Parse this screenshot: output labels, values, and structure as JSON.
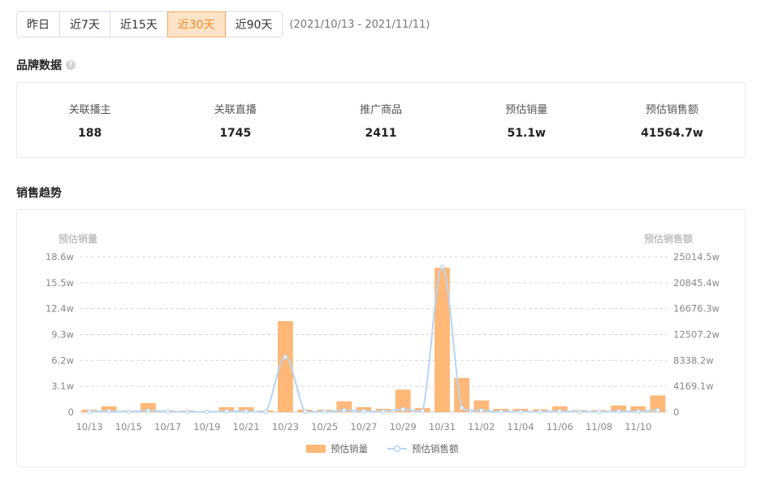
{
  "range": {
    "buttons": [
      "昨日",
      "近7天",
      "近15天",
      "近30天",
      "近90天"
    ],
    "active_index": 3,
    "date_text": "(2021/10/13 - 2021/11/11)"
  },
  "brand": {
    "title": "品牌数据",
    "help_icon": "?",
    "stats": [
      {
        "label": "关联播主",
        "value": "188"
      },
      {
        "label": "关联直播",
        "value": "1745"
      },
      {
        "label": "推广商品",
        "value": "2411"
      },
      {
        "label": "预估销量",
        "value": "51.1w"
      },
      {
        "label": "预估销售额",
        "value": "41564.7w"
      }
    ]
  },
  "trend": {
    "title": "销售趋势"
  },
  "colors": {
    "bar": "#ffb877",
    "line": "#b7d5f5",
    "accent": "#f08a2b"
  },
  "chart_data": {
    "type": "bar",
    "categories": [
      "10/13",
      "10/14",
      "10/15",
      "10/16",
      "10/17",
      "10/18",
      "10/19",
      "10/20",
      "10/21",
      "10/22",
      "10/23",
      "10/24",
      "10/25",
      "10/26",
      "10/27",
      "10/28",
      "10/29",
      "10/30",
      "10/31",
      "11/01",
      "11/02",
      "11/03",
      "11/04",
      "11/05",
      "11/06",
      "11/07",
      "11/08",
      "11/09",
      "11/10",
      "11/11"
    ],
    "x_tick_labels": [
      "10/13",
      "10/15",
      "10/17",
      "10/19",
      "10/21",
      "10/23",
      "10/25",
      "10/27",
      "10/29",
      "10/31",
      "11/02",
      "11/04",
      "11/06",
      "11/08",
      "11/10"
    ],
    "y_left_name": "预估销量",
    "y_right_name": "预估销售额",
    "y_left_ticks": [
      "0",
      "3.1w",
      "6.2w",
      "9.3w",
      "12.4w",
      "15.5w",
      "18.6w"
    ],
    "y_right_ticks": [
      "0",
      "4169.1w",
      "8338.2w",
      "12507.2w",
      "16676.3w",
      "20845.4w",
      "25014.5w"
    ],
    "y_left_max": 18.6,
    "y_right_max": 25014.5,
    "grid": true,
    "legend_position": "bottom",
    "series": [
      {
        "name": "预估销量",
        "type": "bar",
        "axis": "left",
        "values": [
          0.3,
          0.7,
          0.2,
          1.1,
          0.2,
          0.2,
          0.15,
          0.6,
          0.6,
          0.2,
          10.9,
          0.3,
          0.3,
          1.3,
          0.6,
          0.4,
          2.7,
          0.5,
          17.3,
          4.1,
          1.4,
          0.4,
          0.4,
          0.35,
          0.7,
          0.25,
          0.25,
          0.8,
          0.7,
          2.0
        ]
      },
      {
        "name": "预估销售额",
        "type": "line",
        "axis": "right",
        "values": [
          80,
          150,
          60,
          250,
          90,
          50,
          40,
          130,
          120,
          60,
          8900,
          100,
          80,
          300,
          150,
          100,
          450,
          200,
          23400,
          700,
          280,
          90,
          80,
          70,
          150,
          60,
          60,
          120,
          110,
          300
        ]
      }
    ]
  }
}
